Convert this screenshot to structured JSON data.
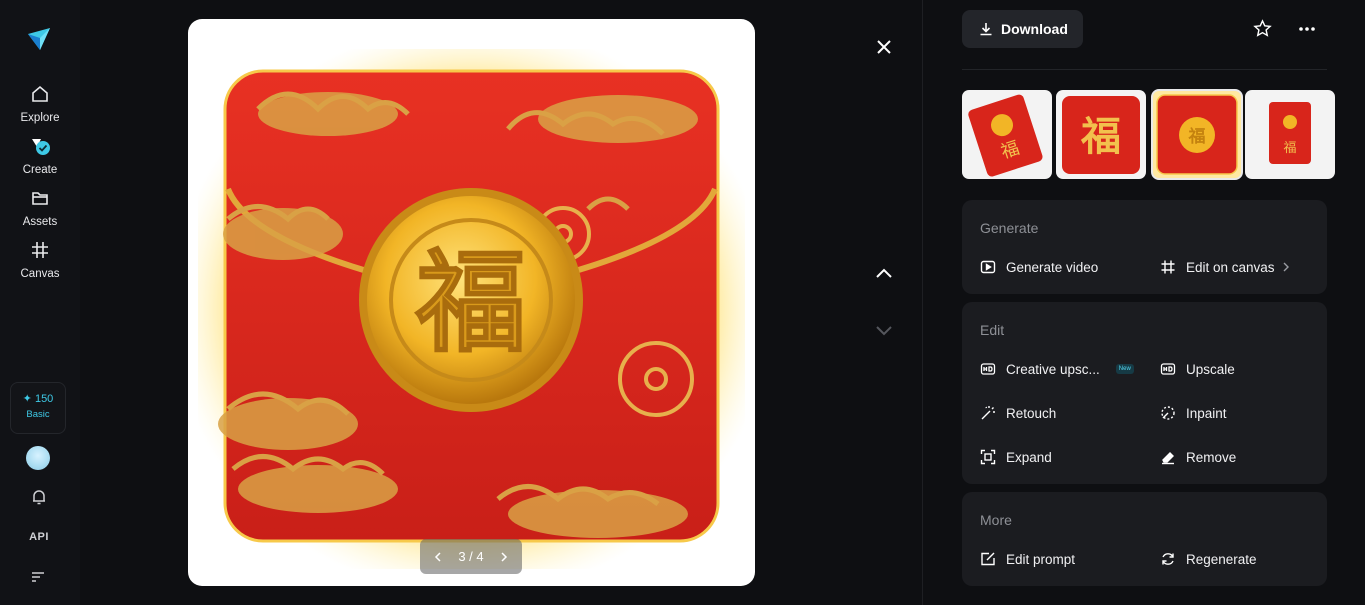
{
  "nav": {
    "items": [
      {
        "label": "Explore",
        "icon": "home-icon"
      },
      {
        "label": "Create",
        "icon": "create-icon"
      },
      {
        "label": "Assets",
        "icon": "folder-icon"
      },
      {
        "label": "Canvas",
        "icon": "canvas-icon"
      }
    ],
    "credits": {
      "amount": "✦ 150",
      "plan": "Basic"
    },
    "api_label": "API"
  },
  "viewer": {
    "page_indicator": "3 / 4"
  },
  "toolbar": {
    "download_label": "Download"
  },
  "sections": {
    "generate": {
      "title": "Generate",
      "actions": [
        "Generate video",
        "Edit on canvas"
      ]
    },
    "edit": {
      "title": "Edit",
      "actions": [
        "Creative upsc...",
        "Upscale",
        "Retouch",
        "Inpaint",
        "Expand",
        "Remove"
      ],
      "new_badge": "New"
    },
    "more": {
      "title": "More",
      "actions": [
        "Edit prompt",
        "Regenerate"
      ]
    }
  },
  "colors": {
    "accent": "#3ec9e6",
    "panel": "#1b1c20",
    "background": "#0e0f12",
    "envelope_red": "#d9251c",
    "gold": "#e0a62a"
  }
}
